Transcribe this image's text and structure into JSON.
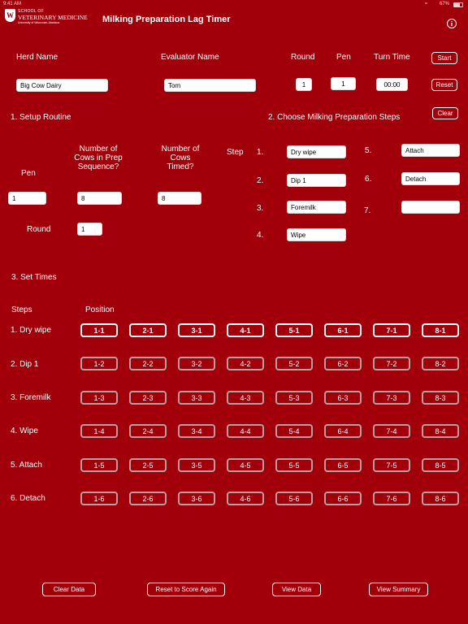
{
  "status_bar": {
    "time": "9:41 AM",
    "battery": "67%"
  },
  "logo": {
    "line1": "SCHOOL OF",
    "line2": "VETERINARY MEDICINE",
    "line3": "University of Wisconsin–Madison",
    "seal_letter": "W"
  },
  "app": {
    "title": "Milking Preparation Lag Timer"
  },
  "header": {
    "herd_label": "Herd Name",
    "herd_value": "Big Cow Dairy",
    "evaluator_label": "Evaluator Name",
    "evaluator_value": "Tom",
    "round_label": "Round",
    "round_value": "1",
    "pen_label": "Pen",
    "pen_value": "1",
    "turn_label": "Turn Time",
    "turn_value": "00:00",
    "start_label": "Start",
    "reset_label": "Reset"
  },
  "setup": {
    "title": "1. Setup Routine",
    "pen_label": "Pen",
    "pen_value": "1",
    "cows_prep_label": "Number of Cows in Prep Sequence?",
    "cows_prep_value": "8",
    "cows_timed_label": "Number of Cows Timed?",
    "cows_timed_value": "8",
    "round_label": "Round",
    "round_value": "1"
  },
  "steps_choose": {
    "title": "2. Choose Milking Preparation Steps",
    "clear_label": "Clear",
    "step_label": "Step",
    "items": [
      {
        "num": "1.",
        "value": "Dry wipe"
      },
      {
        "num": "2.",
        "value": "Dip 1"
      },
      {
        "num": "3.",
        "value": "Foremilk"
      },
      {
        "num": "4.",
        "value": "Wipe"
      },
      {
        "num": "5.",
        "value": "Attach"
      },
      {
        "num": "6.",
        "value": "Detach"
      },
      {
        "num": "7.",
        "value": ""
      }
    ]
  },
  "times": {
    "title": "3. Set Times",
    "steps_header": "Steps",
    "position_header": "Position",
    "rows": [
      {
        "label": "1. Dry wipe",
        "buttons": [
          "1-1",
          "2-1",
          "3-1",
          "4-1",
          "5-1",
          "6-1",
          "7-1",
          "8-1"
        ]
      },
      {
        "label": "2. Dip 1",
        "buttons": [
          "1-2",
          "2-2",
          "3-2",
          "4-2",
          "5-2",
          "6-2",
          "7-2",
          "8-2"
        ]
      },
      {
        "label": "3. Foremilk",
        "buttons": [
          "1-3",
          "2-3",
          "3-3",
          "4-3",
          "5-3",
          "6-3",
          "7-3",
          "8-3"
        ]
      },
      {
        "label": "4. Wipe",
        "buttons": [
          "1-4",
          "2-4",
          "3-4",
          "4-4",
          "5-4",
          "6-4",
          "7-4",
          "8-4"
        ]
      },
      {
        "label": "5. Attach",
        "buttons": [
          "1-5",
          "2-5",
          "3-5",
          "4-5",
          "5-5",
          "6-5",
          "7-5",
          "8-5"
        ]
      },
      {
        "label": "6. Detach",
        "buttons": [
          "1-6",
          "2-6",
          "3-6",
          "4-6",
          "5-6",
          "6-6",
          "7-6",
          "8-6"
        ]
      }
    ]
  },
  "footer": {
    "clear_data": "Clear Data",
    "reset_score": "Reset to Score Again",
    "view_data": "View Data",
    "view_summary": "View Summary"
  },
  "colors": {
    "background": "#a1000a",
    "inactive_border": "#b9a0a0"
  }
}
